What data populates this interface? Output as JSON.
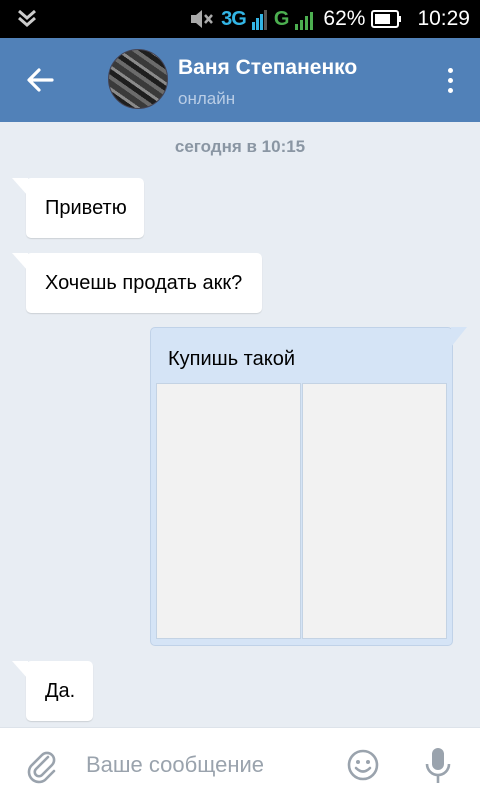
{
  "status_bar": {
    "network_1": "3G",
    "network_2": "G",
    "battery": "62%",
    "time": "10:29"
  },
  "header": {
    "contact_name": "Ваня Степаненко",
    "contact_status": "онлайн",
    "accent_color": "#5181b8"
  },
  "chat": {
    "date_separator": "сегодня в 10:15",
    "messages": [
      {
        "direction": "in",
        "text": "Приветю"
      },
      {
        "direction": "in",
        "text": "Хочешь продать акк?"
      },
      {
        "direction": "out",
        "text": "Купишь такой",
        "attachments": 2
      },
      {
        "direction": "in",
        "text": "Да."
      }
    ]
  },
  "composer": {
    "placeholder": "Ваше сообщение",
    "icons": [
      "paperclip-icon",
      "emoji-icon",
      "microphone-icon"
    ]
  }
}
